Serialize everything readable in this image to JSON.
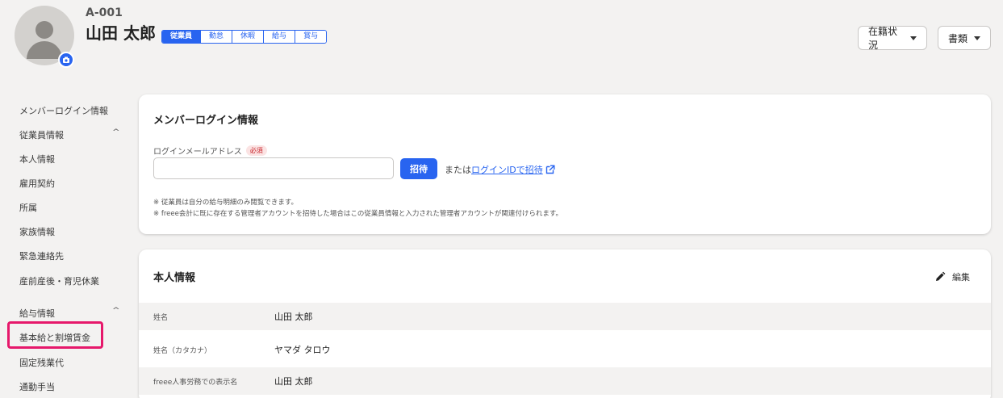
{
  "header": {
    "employee_code": "A-001",
    "employee_name": "山田 太郎",
    "tabs": [
      "従業員",
      "勤怠",
      "休暇",
      "給与",
      "賞与"
    ],
    "status_button": "在籍状況",
    "documents_button": "書類"
  },
  "sidebar": {
    "member_login": "メンバーログイン情報",
    "group_employee": "従業員情報",
    "employee_items": [
      "本人情報",
      "雇用契約",
      "所属",
      "家族情報",
      "緊急連絡先",
      "産前産後・育児休業"
    ],
    "group_payroll": "給与情報",
    "payroll_items": [
      "基本給と割増賃金",
      "固定残業代",
      "通勤手当"
    ]
  },
  "login_card": {
    "title": "メンバーログイン情報",
    "email_label": "ログインメールアドレス",
    "required_badge": "必須",
    "email_value": "",
    "invite_button": "招待",
    "or_prefix": "または",
    "invite_by_id_link": "ログインIDで招待",
    "note1": "※ 従業員は自分の給与明細のみ閲覧できます。",
    "note2": "※ freee会計に既に存在する管理者アカウントを招待した場合はこの従業員情報と入力された管理者アカウントが関連付けられます。"
  },
  "personal_card": {
    "title": "本人情報",
    "edit_button": "編集",
    "rows": [
      {
        "label": "姓名",
        "value": "山田 太郎"
      },
      {
        "label": "姓名（カタカナ）",
        "value": "ヤマダ タロウ"
      },
      {
        "label": "freee人事労務での表示名",
        "value": "山田 太郎"
      }
    ]
  },
  "colors": {
    "accent": "#2864f0",
    "highlight": "#e6186b"
  }
}
